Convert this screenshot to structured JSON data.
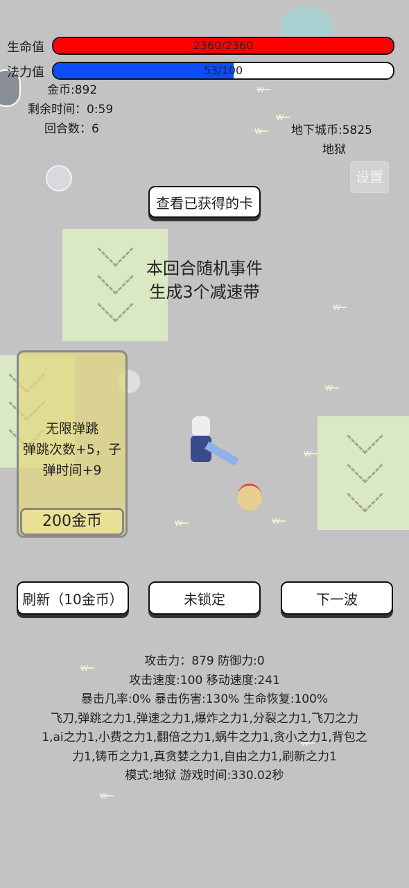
{
  "hud": {
    "hp_label": "生命值",
    "hp_text": "2360/2360",
    "hp_fraction": 1.0,
    "hp_color": "#ff0000",
    "mp_label": "法力值",
    "mp_text": "53/100",
    "mp_fraction": 0.53,
    "mp_color": "#0b4dff",
    "gold": "金币:892",
    "time_left": "剩余时间：0:59",
    "round": "回合数：6",
    "dungeon_coin": "地下城币:5825",
    "mode_name": "地狱",
    "settings_label": "设置"
  },
  "view_cards_label": "查看已获得的卡",
  "event": {
    "title": "本回合随机事件",
    "description": "生成3个减速带"
  },
  "shop_card": {
    "name_line1": "无限弹跳",
    "name_line2": "弹跳次数+5，子",
    "name_line3": "弹时间+9",
    "price": "200金币"
  },
  "buttons": {
    "refresh": "刷新（10金币）",
    "lock": "未锁定",
    "next_wave": "下一波"
  },
  "stats": {
    "line1": "攻击力：879 防御力:0",
    "line2": "攻击速度:100 移动速度:241",
    "line3": "暴击几率:0% 暴击伤害:130% 生命恢复:100%",
    "line4": "飞刀,弹跳之力1,弹速之力1,爆炸之力1,分裂之力1,飞刀之力",
    "line5": "1,ai之力1,小费之力1,翻倍之力1,蜗牛之力1,贪小之力1,背包之",
    "line6": "力1,铸币之力1,真贪婪之力1,自由之力1,刷新之力1",
    "line7": "模式:地狱 游戏时间:330.02秒"
  }
}
